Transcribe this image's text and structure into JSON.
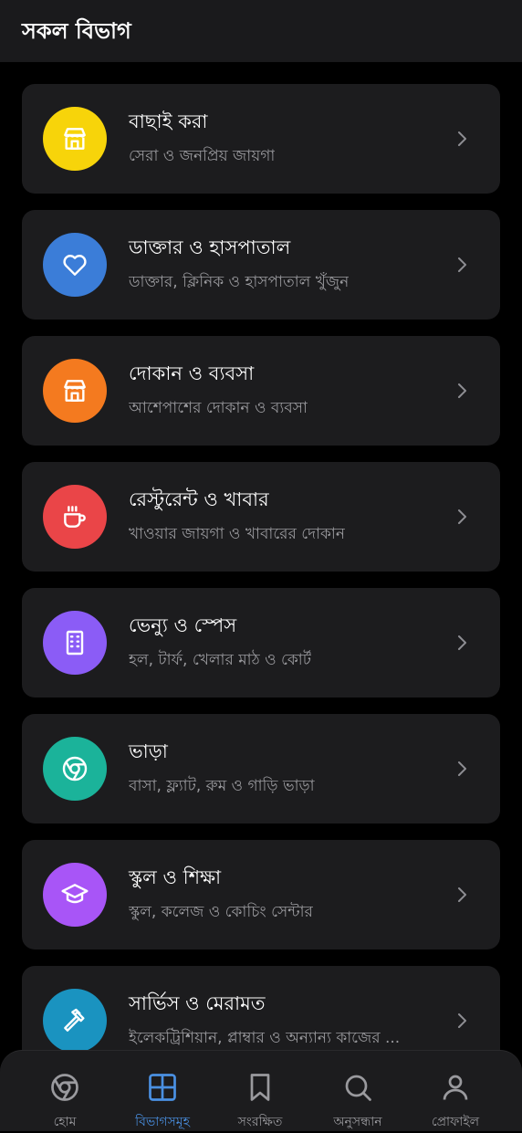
{
  "header": {
    "title": "সকল বিভাগ"
  },
  "categories": [
    {
      "title": "বাছাই করা",
      "subtitle": "সেরা ও জনপ্রিয় জায়গা",
      "color": "#f7d40a",
      "icon": "store-icon"
    },
    {
      "title": "ডাক্তার ও হাসপাতাল",
      "subtitle": "ডাক্তার, ক্লিনিক ও হাসপাতাল খুঁজুন",
      "color": "#3b7dd8",
      "icon": "heart-icon"
    },
    {
      "title": "দোকান ও ব্যবসা",
      "subtitle": "আশেপাশের দোকান ও ব্যবসা",
      "color": "#f47a1f",
      "icon": "store-icon"
    },
    {
      "title": "রেস্টুরেন্ট ও খাবার",
      "subtitle": "খাওয়ার জায়গা ও খাবারের দোকান",
      "color": "#ea4548",
      "icon": "coffee-icon"
    },
    {
      "title": "ভেন্যু ও স্পেস",
      "subtitle": "হল, টার্ফ, খেলার মাঠ ও কোর্ট",
      "color": "#8b5cf6",
      "icon": "building-icon"
    },
    {
      "title": "ভাড়া",
      "subtitle": "বাসা, ফ্ল্যাট, রুম ও গাড়ি ভাড়া",
      "color": "#1bb39a",
      "icon": "chrome-icon"
    },
    {
      "title": "স্কুল ও শিক্ষা",
      "subtitle": "স্কুল, কলেজ ও কোচিং সেন্টার",
      "color": "#a855f7",
      "icon": "graduation-cap-icon"
    },
    {
      "title": "সার্ভিস ও মেরামত",
      "subtitle": "ইলেকট্রিশিয়ান, প্লাম্বার ও অন্যান্য কাজের ...",
      "color": "#1a93c0",
      "icon": "hammer-icon"
    }
  ],
  "bottom_nav": [
    {
      "label": "হোম",
      "icon": "chrome-icon",
      "active": false
    },
    {
      "label": "বিভাগসমূহ",
      "icon": "grid-icon",
      "active": true
    },
    {
      "label": "সংরক্ষিত",
      "icon": "bookmark-icon",
      "active": false
    },
    {
      "label": "অনুসন্ধান",
      "icon": "search-icon",
      "active": false
    },
    {
      "label": "প্রোফাইল",
      "icon": "user-icon",
      "active": false
    }
  ],
  "colors": {
    "accent": "#4a90e2",
    "card_bg": "#1c1c1e",
    "subtitle": "#9a9a9e"
  }
}
